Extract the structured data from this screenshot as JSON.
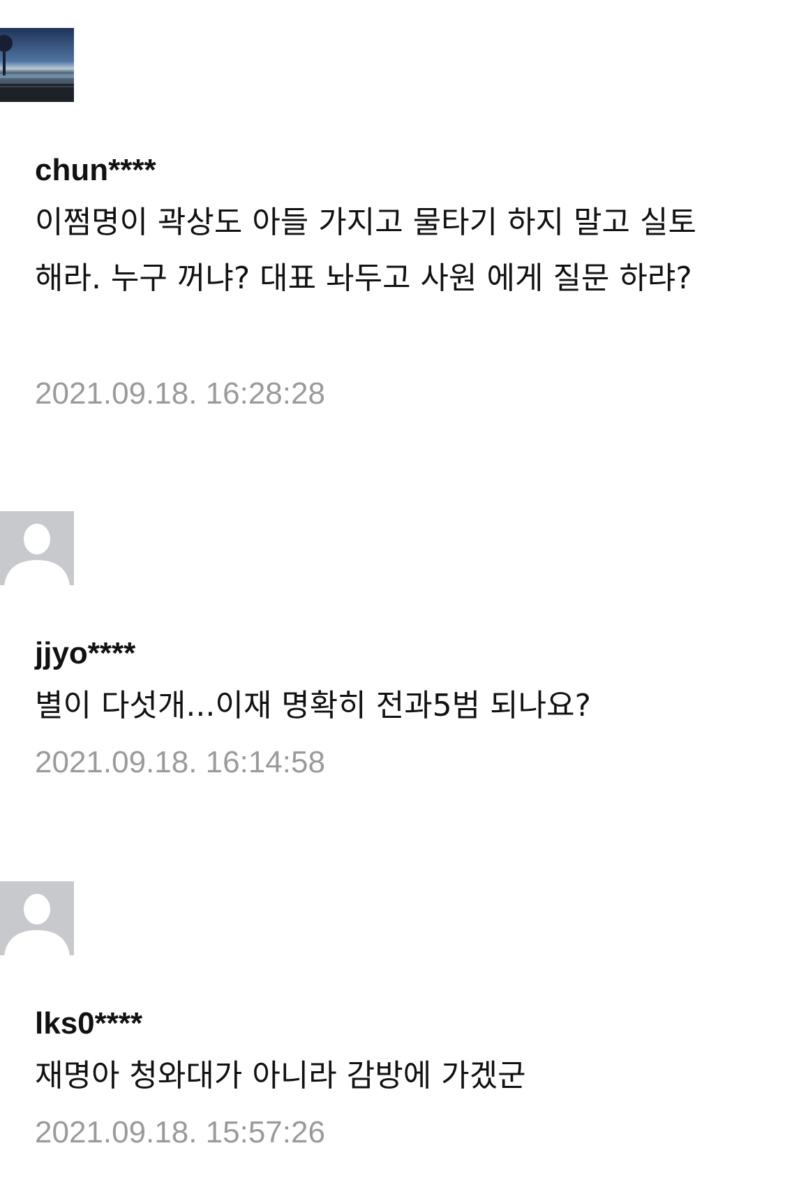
{
  "comments": [
    {
      "avatar": "ocean-sunset-photo",
      "author": "chun****",
      "body": "이쩜명이 곽상도 아들 가지고 물타기 하지 말고 실토 해라. 누구 꺼냐? 대표 놔두고 사원 에게 질문 하랴?",
      "timestamp": "2021.09.18. 16:28:28"
    },
    {
      "avatar": "default-user-icon",
      "author": "jjyo****",
      "body": "별이 다섯개...이재 명확히 전과5범 되나요?",
      "timestamp": "2021.09.18. 16:14:58"
    },
    {
      "avatar": "default-user-icon",
      "author": "lks0****",
      "body": "재명아 청와대가 아니라 감방에 가겠군",
      "timestamp": "2021.09.18. 15:57:26"
    }
  ]
}
